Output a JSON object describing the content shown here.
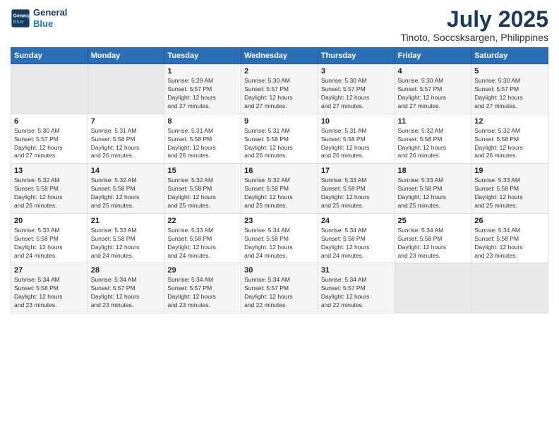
{
  "logo": {
    "line1": "General",
    "line2": "Blue"
  },
  "title": "July 2025",
  "subtitle": "Tinoto, Soccsksargen, Philippines",
  "header": {
    "days": [
      "Sunday",
      "Monday",
      "Tuesday",
      "Wednesday",
      "Thursday",
      "Friday",
      "Saturday"
    ]
  },
  "weeks": [
    {
      "cells": [
        {
          "day": "",
          "info": ""
        },
        {
          "day": "",
          "info": ""
        },
        {
          "day": "1",
          "info": "Sunrise: 5:29 AM\nSunset: 5:57 PM\nDaylight: 12 hours\nand 27 minutes."
        },
        {
          "day": "2",
          "info": "Sunrise: 5:30 AM\nSunset: 5:57 PM\nDaylight: 12 hours\nand 27 minutes."
        },
        {
          "day": "3",
          "info": "Sunrise: 5:30 AM\nSunset: 5:57 PM\nDaylight: 12 hours\nand 27 minutes."
        },
        {
          "day": "4",
          "info": "Sunrise: 5:30 AM\nSunset: 5:57 PM\nDaylight: 12 hours\nand 27 minutes."
        },
        {
          "day": "5",
          "info": "Sunrise: 5:30 AM\nSunset: 5:57 PM\nDaylight: 12 hours\nand 27 minutes."
        }
      ]
    },
    {
      "cells": [
        {
          "day": "6",
          "info": "Sunrise: 5:30 AM\nSunset: 5:57 PM\nDaylight: 12 hours\nand 27 minutes."
        },
        {
          "day": "7",
          "info": "Sunrise: 5:31 AM\nSunset: 5:58 PM\nDaylight: 12 hours\nand 26 minutes."
        },
        {
          "day": "8",
          "info": "Sunrise: 5:31 AM\nSunset: 5:58 PM\nDaylight: 12 hours\nand 26 minutes."
        },
        {
          "day": "9",
          "info": "Sunrise: 5:31 AM\nSunset: 5:58 PM\nDaylight: 12 hours\nand 26 minutes."
        },
        {
          "day": "10",
          "info": "Sunrise: 5:31 AM\nSunset: 5:58 PM\nDaylight: 12 hours\nand 26 minutes."
        },
        {
          "day": "11",
          "info": "Sunrise: 5:32 AM\nSunset: 5:58 PM\nDaylight: 12 hours\nand 26 minutes."
        },
        {
          "day": "12",
          "info": "Sunrise: 5:32 AM\nSunset: 5:58 PM\nDaylight: 12 hours\nand 26 minutes."
        }
      ]
    },
    {
      "cells": [
        {
          "day": "13",
          "info": "Sunrise: 5:32 AM\nSunset: 5:58 PM\nDaylight: 12 hours\nand 26 minutes."
        },
        {
          "day": "14",
          "info": "Sunrise: 5:32 AM\nSunset: 5:58 PM\nDaylight: 12 hours\nand 25 minutes."
        },
        {
          "day": "15",
          "info": "Sunrise: 5:32 AM\nSunset: 5:58 PM\nDaylight: 12 hours\nand 25 minutes."
        },
        {
          "day": "16",
          "info": "Sunrise: 5:32 AM\nSunset: 5:58 PM\nDaylight: 12 hours\nand 25 minutes."
        },
        {
          "day": "17",
          "info": "Sunrise: 5:33 AM\nSunset: 5:58 PM\nDaylight: 12 hours\nand 25 minutes."
        },
        {
          "day": "18",
          "info": "Sunrise: 5:33 AM\nSunset: 5:58 PM\nDaylight: 12 hours\nand 25 minutes."
        },
        {
          "day": "19",
          "info": "Sunrise: 5:33 AM\nSunset: 5:58 PM\nDaylight: 12 hours\nand 25 minutes."
        }
      ]
    },
    {
      "cells": [
        {
          "day": "20",
          "info": "Sunrise: 5:33 AM\nSunset: 5:58 PM\nDaylight: 12 hours\nand 24 minutes."
        },
        {
          "day": "21",
          "info": "Sunrise: 5:33 AM\nSunset: 5:58 PM\nDaylight: 12 hours\nand 24 minutes."
        },
        {
          "day": "22",
          "info": "Sunrise: 5:33 AM\nSunset: 5:58 PM\nDaylight: 12 hours\nand 24 minutes."
        },
        {
          "day": "23",
          "info": "Sunrise: 5:34 AM\nSunset: 5:58 PM\nDaylight: 12 hours\nand 24 minutes."
        },
        {
          "day": "24",
          "info": "Sunrise: 5:34 AM\nSunset: 5:58 PM\nDaylight: 12 hours\nand 24 minutes."
        },
        {
          "day": "25",
          "info": "Sunrise: 5:34 AM\nSunset: 5:58 PM\nDaylight: 12 hours\nand 23 minutes."
        },
        {
          "day": "26",
          "info": "Sunrise: 5:34 AM\nSunset: 5:58 PM\nDaylight: 12 hours\nand 23 minutes."
        }
      ]
    },
    {
      "cells": [
        {
          "day": "27",
          "info": "Sunrise: 5:34 AM\nSunset: 5:58 PM\nDaylight: 12 hours\nand 23 minutes."
        },
        {
          "day": "28",
          "info": "Sunrise: 5:34 AM\nSunset: 5:57 PM\nDaylight: 12 hours\nand 23 minutes."
        },
        {
          "day": "29",
          "info": "Sunrise: 5:34 AM\nSunset: 5:57 PM\nDaylight: 12 hours\nand 23 minutes."
        },
        {
          "day": "30",
          "info": "Sunrise: 5:34 AM\nSunset: 5:57 PM\nDaylight: 12 hours\nand 22 minutes."
        },
        {
          "day": "31",
          "info": "Sunrise: 5:34 AM\nSunset: 5:57 PM\nDaylight: 12 hours\nand 22 minutes."
        },
        {
          "day": "",
          "info": ""
        },
        {
          "day": "",
          "info": ""
        }
      ]
    }
  ]
}
